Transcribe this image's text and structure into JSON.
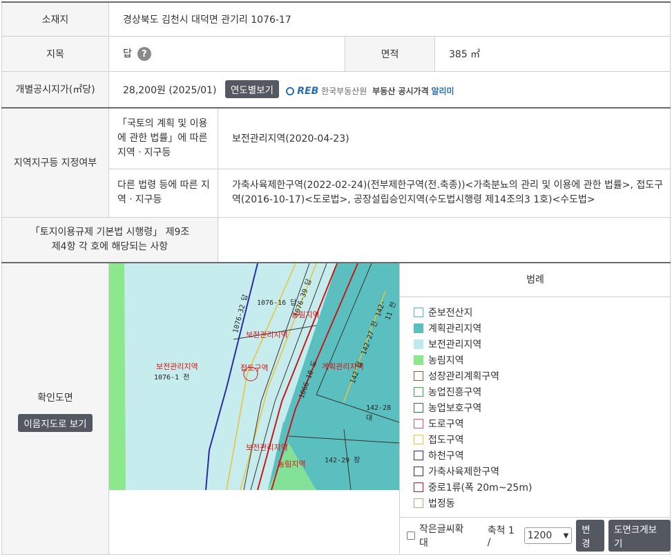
{
  "rows": {
    "location_label": "소재지",
    "location_value": "경상북도 김천시 대덕면 관기리 1076-17",
    "category_label": "지목",
    "category_value": "답",
    "area_label": "면적",
    "area_value": "385 ㎡",
    "price_label": "개별공시지가(㎡당)",
    "price_value": "28,200원 (2025/01)",
    "price_button": "연도별보기",
    "reb_logo": "REB",
    "reb_name": "한국부동산원",
    "reb_service": "부동산 공시가격",
    "reb_service_hl": "알리미",
    "zone_label": "지역지구등 지정여부",
    "zone_sub1": "「국토의 계획 및 이용에 관한 법률」에 따른 지역ㆍ지구등",
    "zone_val1": "보전관리지역(2020-04-23)",
    "zone_sub2": "다른 법령 등에 따른 지역ㆍ지구등",
    "zone_val2": "가축사육제한구역(2022-02-24)(전부제한구역(전.축종))<가축분뇨의 관리 및 이용에 관한 법률>, 접도구역(2016-10-17)<도로법>, 공장설립승인지역(수도법시행령 제14조의3 1호)<수도법>",
    "reg_label": "「토지이용규제 기본법 시행령」 제9조 제4항 각 호에 해당되는 사항",
    "reg_value": "",
    "map_label": "확인도면",
    "map_button": "이음지도로 보기"
  },
  "map": {
    "labels": [
      "1076-16 답",
      "1076-32 답",
      "1076-39 답",
      "보전관리지역",
      "보전관리지역",
      "1076-1 천",
      "농림지역",
      "접도구역",
      "1066-10 도",
      "계획관리지역",
      "142-28 대",
      "142-29 장",
      "보전관리지역",
      "농림지역",
      "142 답",
      "142-27 전",
      "142-11 전"
    ]
  },
  "legend": {
    "title": "범례",
    "items": [
      {
        "label": "준보전산지",
        "fill": "#ffffff",
        "border": "#4fb8a8"
      },
      {
        "label": "계획관리지역",
        "fill": "#5cbfbf",
        "border": "#5cbfbf"
      },
      {
        "label": "보전관리지역",
        "fill": "#bfe9ec",
        "border": "#bfe9ec"
      },
      {
        "label": "농림지역",
        "fill": "#8de88d",
        "border": "#8de88d"
      },
      {
        "label": "성장관리계획구역",
        "fill": "#ffffff",
        "border": "#8b5a2b"
      },
      {
        "label": "농업진흥구역",
        "fill": "#ffffff",
        "border": "#3caa3c"
      },
      {
        "label": "농업보호구역",
        "fill": "#ffffff",
        "border": "#2e7d2e"
      },
      {
        "label": "도로구역",
        "fill": "#ffffff",
        "border": "#e0507a"
      },
      {
        "label": "접도구역",
        "fill": "#ffffff",
        "border": "#e8c430"
      },
      {
        "label": "하천구역",
        "fill": "#ffffff",
        "border": "#2a2aa8"
      },
      {
        "label": "가축사육제한구역",
        "fill": "#ffffff",
        "border": "#333333"
      },
      {
        "label": "중로1류(폭 20m~25m)",
        "fill": "#ffffff",
        "border": "#c21a1a"
      },
      {
        "label": "법정동",
        "fill": "#ffffff",
        "border": "#c9a27a"
      }
    ]
  },
  "controls": {
    "small_text_label": "작은글씨확대",
    "scale_label": "축척 1 /",
    "scale_value": "1200",
    "change_button": "변경",
    "enlarge_button": "도면크게보기"
  }
}
